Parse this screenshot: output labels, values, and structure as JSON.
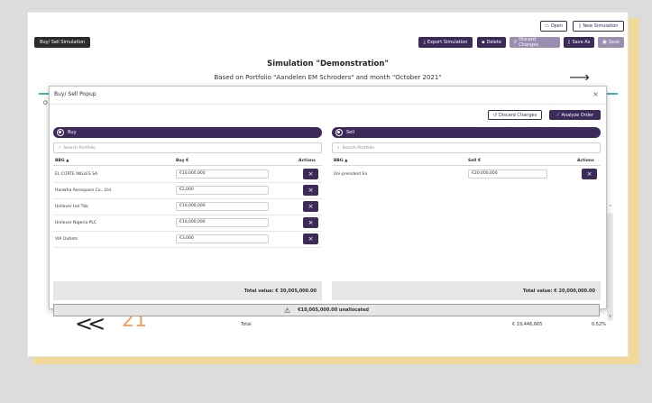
{
  "toolbar": {
    "open_label": "Open",
    "new_simulation_label": "New Simulation",
    "buy_sell_simulation_label": "Buy/ Sell Simulation",
    "export_label": "Export Simulation",
    "delete_label": "Delete",
    "discard_label": "Discard Changes",
    "save_as_label": "Save As",
    "save_label": "Save"
  },
  "simulation": {
    "title": "Simulation \"Demonstration\"",
    "subtitle": "Based on Portfolio \"Aandelen EM Schroders\" and month \"October 2021\"",
    "side_letter": "O"
  },
  "background": {
    "bottom_left_glyph": "<<",
    "bottom_number": "21",
    "total_label": "Total",
    "total_value": "€ 19,446,665",
    "total_percent": "0.52%"
  },
  "popup": {
    "title": "Buy/ Sell Popup",
    "close_glyph": "×",
    "discard_label": "Discard Changes",
    "analyze_label": "Analyze Order",
    "unallocated_text": "€10,005,000.00 unallocated",
    "buy": {
      "header": "Buy",
      "search_placeholder": "Search Portfolio",
      "col_bbg": "BBG ▲",
      "col_amount": "Buy €",
      "col_actions": "Actions",
      "rows": [
        {
          "name": "EL CORTE INGLES SA",
          "amount": "€10,000,000"
        },
        {
          "name": "Hanwha Aerospace Co., Ltd.",
          "amount": "€2,000"
        },
        {
          "name": "Unilever Ind Tbk",
          "amount": "€10,000,000"
        },
        {
          "name": "Unilever Nigeria PLC",
          "amount": "€10,000,000"
        },
        {
          "name": "VIA Outlets",
          "amount": "€3,000"
        }
      ],
      "total": "Total value: € 30,005,000.00"
    },
    "sell": {
      "header": "Sell",
      "search_placeholder": "Search Portfolio",
      "col_bbg": "BBG ▲",
      "col_amount": "Sell €",
      "col_actions": "Actions",
      "rows": [
        {
          "name": "Uni-president En",
          "amount": "€20,000,000"
        }
      ],
      "total": "Total value: € 20,000,000.00"
    }
  },
  "colors": {
    "primary": "#3b2a5a",
    "accent_line": "#3fb3c3",
    "frame_shadow": "#f0d99a",
    "orange_number": "#f0a060"
  }
}
